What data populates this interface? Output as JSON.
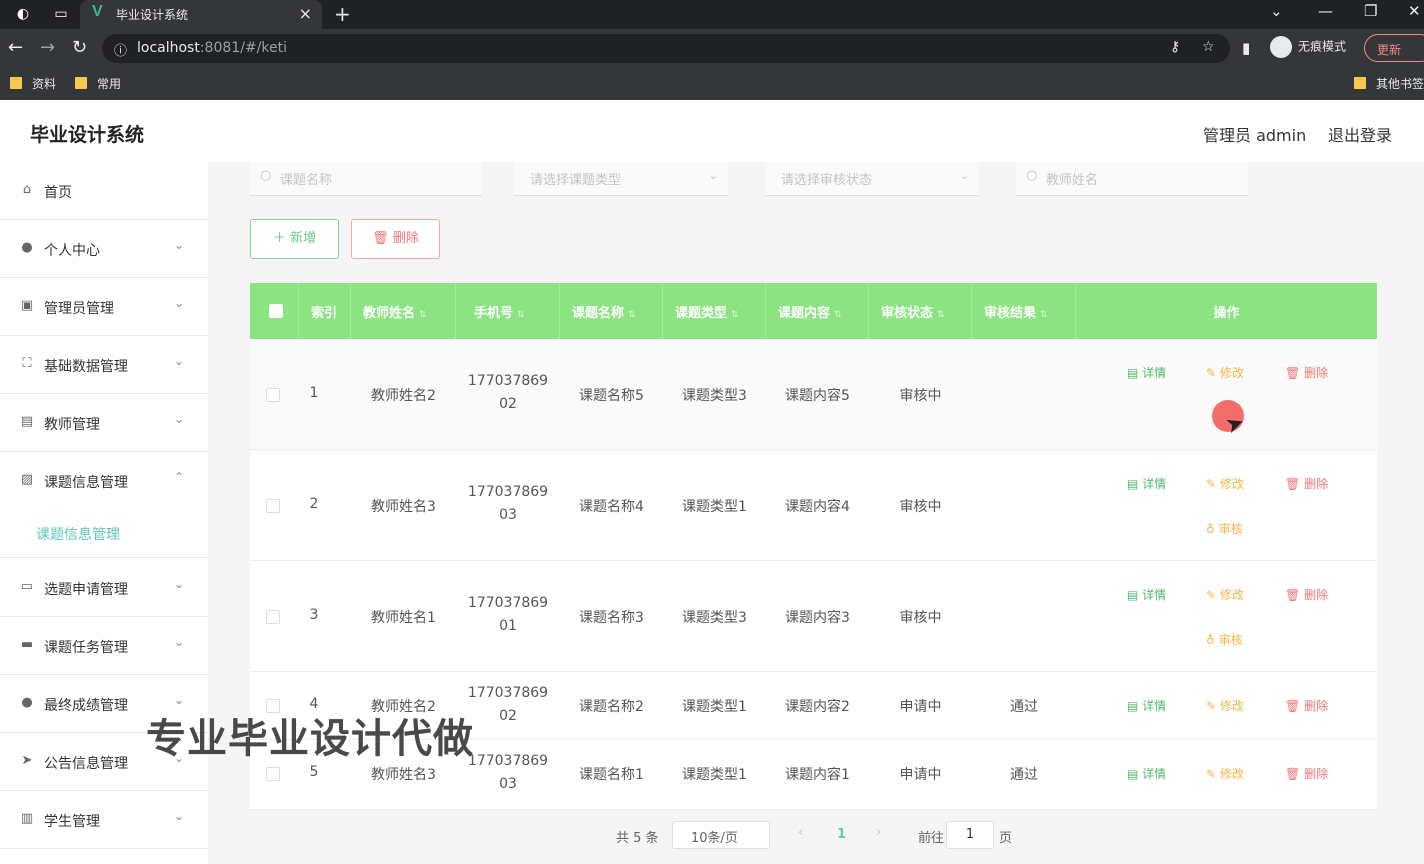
{
  "browser": {
    "tab_title": "毕业设计系统",
    "url_host": "localhost",
    "url_rest": ":8081/#/keti",
    "incognito_label": "无痕模式",
    "update_label": "更新",
    "bookmarks": [
      "资料",
      "常用"
    ],
    "other_bookmarks": "其他书签"
  },
  "app": {
    "title": "毕业设计系统",
    "admin_user": "管理员 admin",
    "logout": "退出登录"
  },
  "sidebar": {
    "items": [
      {
        "label": "首页",
        "icon": "home-icon"
      },
      {
        "label": "个人中心",
        "icon": "user-icon"
      },
      {
        "label": "管理员管理",
        "icon": "clipboard-icon"
      },
      {
        "label": "基础数据管理",
        "icon": "frame-icon"
      },
      {
        "label": "教师管理",
        "icon": "id-card-icon"
      },
      {
        "label": "课题信息管理",
        "icon": "chart-icon"
      },
      {
        "label": "选题申请管理",
        "icon": "chat-icon"
      },
      {
        "label": "课题任务管理",
        "icon": "monitor-icon"
      },
      {
        "label": "最终成绩管理",
        "icon": "trophy-icon"
      },
      {
        "label": "公告信息管理",
        "icon": "send-icon"
      },
      {
        "label": "学生管理",
        "icon": "books-icon"
      }
    ],
    "subitem": "课题信息管理"
  },
  "search": {
    "topic_name_placeholder": "课题名称",
    "topic_type_placeholder": "请选择课题类型",
    "audit_status_placeholder": "请选择审核状态",
    "teacher_name_placeholder": "教师姓名"
  },
  "toolbar": {
    "add_label": "新增",
    "delete_label": "删除"
  },
  "table": {
    "headers": [
      "索引",
      "教师姓名",
      "手机号",
      "课题名称",
      "课题类型",
      "课题内容",
      "审核状态",
      "审核结果",
      "操作"
    ],
    "rows": [
      {
        "index": "1",
        "teacher": "教师姓名2",
        "phone1": "177037869",
        "phone2": "02",
        "topic": "课题名称5",
        "type": "课题类型3",
        "content": "课题内容5",
        "status": "审核中",
        "result": ""
      },
      {
        "index": "2",
        "teacher": "教师姓名3",
        "phone1": "177037869",
        "phone2": "03",
        "topic": "课题名称4",
        "type": "课题类型1",
        "content": "课题内容4",
        "status": "审核中",
        "result": ""
      },
      {
        "index": "3",
        "teacher": "教师姓名1",
        "phone1": "177037869",
        "phone2": "01",
        "topic": "课题名称3",
        "type": "课题类型3",
        "content": "课题内容3",
        "status": "审核中",
        "result": ""
      },
      {
        "index": "4",
        "teacher": "教师姓名2",
        "phone1": "177037869",
        "phone2": "02",
        "topic": "课题名称2",
        "type": "课题类型1",
        "content": "课题内容2",
        "status": "申请中",
        "result": "通过"
      },
      {
        "index": "5",
        "teacher": "教师姓名3",
        "phone1": "177037869",
        "phone2": "03",
        "topic": "课题名称1",
        "type": "课题类型1",
        "content": "课题内容1",
        "status": "申请中",
        "result": "通过"
      }
    ],
    "actions": {
      "detail": "详情",
      "edit": "修改",
      "remove": "删除",
      "audit": "审核"
    }
  },
  "pagination": {
    "total": "共 5 条",
    "page_size": "10条/页",
    "current_page": "1",
    "goto_prefix": "前往",
    "goto_value": "1",
    "goto_suffix": "页"
  },
  "watermark": "专业毕业设计代做",
  "colors": {
    "header_green": "#8be382",
    "accent_teal": "#5fc7b7",
    "danger": "#f07676",
    "warning": "#f3b64a",
    "success": "#54b86c"
  }
}
